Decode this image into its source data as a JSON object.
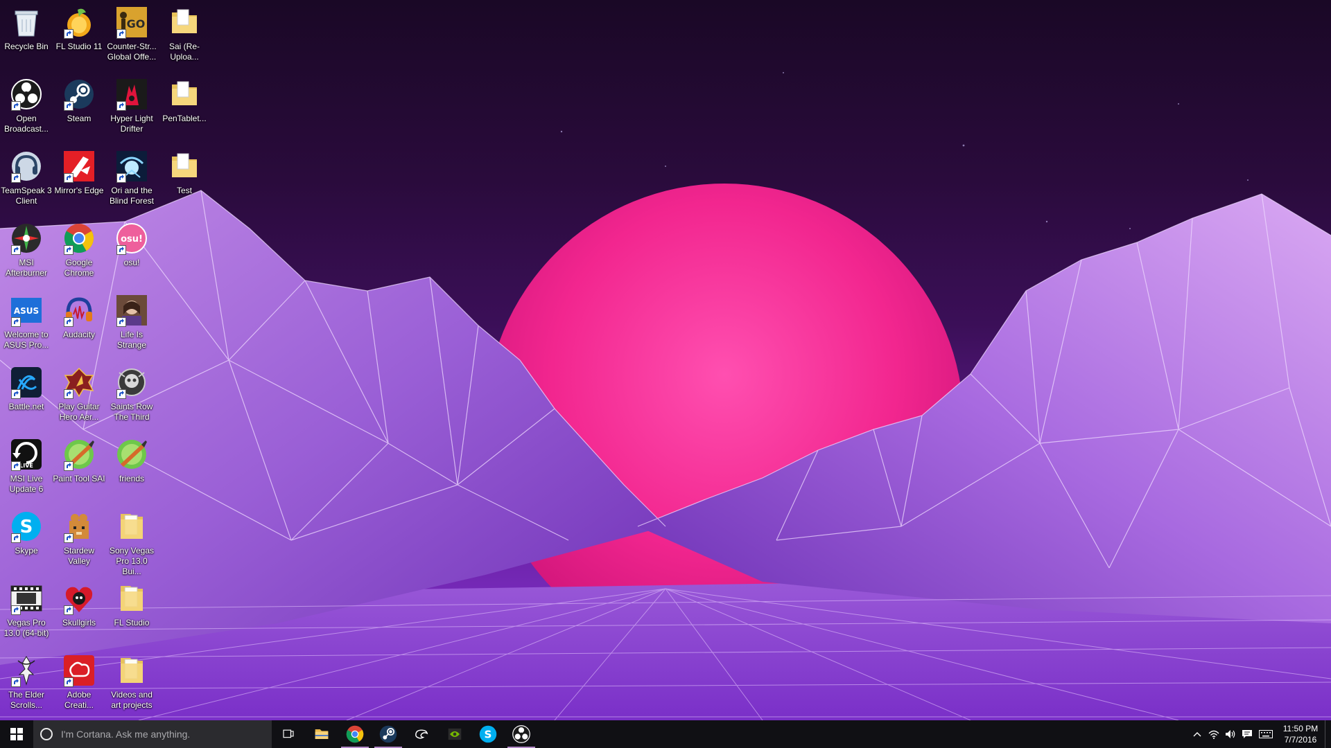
{
  "desktop": {
    "icons": [
      {
        "label": "Recycle Bin",
        "icon": "recycle-bin-icon",
        "col": 0,
        "row": 0,
        "shortcut": false
      },
      {
        "label": "FL Studio 11",
        "icon": "fl-studio-icon",
        "col": 1,
        "row": 0,
        "shortcut": true
      },
      {
        "label": "Counter-Str... Global Offe...",
        "icon": "csgo-icon",
        "col": 2,
        "row": 0,
        "shortcut": true
      },
      {
        "label": "Sai (Re-Uploa...",
        "icon": "folder-icon",
        "col": 3,
        "row": 0,
        "shortcut": false
      },
      {
        "label": "Open Broadcast...",
        "icon": "obs-icon",
        "col": 0,
        "row": 1,
        "shortcut": true
      },
      {
        "label": "Steam",
        "icon": "steam-icon",
        "col": 1,
        "row": 1,
        "shortcut": true
      },
      {
        "label": "Hyper Light Drifter",
        "icon": "hyper-light-drifter-icon",
        "col": 2,
        "row": 1,
        "shortcut": true
      },
      {
        "label": "PenTablet...",
        "icon": "folder-icon",
        "col": 3,
        "row": 1,
        "shortcut": false
      },
      {
        "label": "TeamSpeak 3 Client",
        "icon": "teamspeak-icon",
        "col": 0,
        "row": 2,
        "shortcut": true
      },
      {
        "label": "Mirror's Edge",
        "icon": "mirrors-edge-icon",
        "col": 1,
        "row": 2,
        "shortcut": true
      },
      {
        "label": "Ori and the Blind Forest",
        "icon": "ori-icon",
        "col": 2,
        "row": 2,
        "shortcut": true
      },
      {
        "label": "Test",
        "icon": "folder-icon",
        "col": 3,
        "row": 2,
        "shortcut": false
      },
      {
        "label": "MSI Afterburner",
        "icon": "msi-afterburner-icon",
        "col": 0,
        "row": 3,
        "shortcut": true
      },
      {
        "label": "Google Chrome",
        "icon": "chrome-icon",
        "col": 1,
        "row": 3,
        "shortcut": true
      },
      {
        "label": "osu!",
        "icon": "osu-icon",
        "col": 2,
        "row": 3,
        "shortcut": true
      },
      {
        "label": "Welcome to ASUS Pro...",
        "icon": "asus-icon",
        "col": 0,
        "row": 4,
        "shortcut": true
      },
      {
        "label": "Audacity",
        "icon": "audacity-icon",
        "col": 1,
        "row": 4,
        "shortcut": true
      },
      {
        "label": "Life Is Strange",
        "icon": "life-is-strange-icon",
        "col": 2,
        "row": 4,
        "shortcut": true
      },
      {
        "label": "Battle.net",
        "icon": "battlenet-icon",
        "col": 0,
        "row": 5,
        "shortcut": true
      },
      {
        "label": "Play Guitar Hero Aer...",
        "icon": "guitar-hero-icon",
        "col": 1,
        "row": 5,
        "shortcut": true
      },
      {
        "label": "Saints Row The Third",
        "icon": "saints-row-icon",
        "col": 2,
        "row": 5,
        "shortcut": true
      },
      {
        "label": "MSI Live Update 6",
        "icon": "msi-live-update-icon",
        "col": 0,
        "row": 6,
        "shortcut": true
      },
      {
        "label": "Paint Tool SAI",
        "icon": "paint-tool-sai-icon",
        "col": 1,
        "row": 6,
        "shortcut": true
      },
      {
        "label": "friends",
        "icon": "paint-tool-sai-icon",
        "col": 2,
        "row": 6,
        "shortcut": false
      },
      {
        "label": "Skype",
        "icon": "skype-icon",
        "col": 0,
        "row": 7,
        "shortcut": true
      },
      {
        "label": "Stardew Valley",
        "icon": "stardew-valley-icon",
        "col": 1,
        "row": 7,
        "shortcut": true
      },
      {
        "label": "Sony Vegas Pro 13.0 Bui...",
        "icon": "folder-doc-icon",
        "col": 2,
        "row": 7,
        "shortcut": false
      },
      {
        "label": "Vegas Pro 13.0 (64-bit)",
        "icon": "vegas-pro-icon",
        "col": 0,
        "row": 8,
        "shortcut": true
      },
      {
        "label": "Skullgirls",
        "icon": "skullgirls-icon",
        "col": 1,
        "row": 8,
        "shortcut": true
      },
      {
        "label": "FL Studio",
        "icon": "folder-doc-icon",
        "col": 2,
        "row": 8,
        "shortcut": false
      },
      {
        "label": "The Elder Scrolls...",
        "icon": "elder-scrolls-icon",
        "col": 0,
        "row": 9,
        "shortcut": true
      },
      {
        "label": "Adobe Creati...",
        "icon": "adobe-cc-icon",
        "col": 1,
        "row": 9,
        "shortcut": true
      },
      {
        "label": "Videos and art projects",
        "icon": "folder-doc-icon",
        "col": 2,
        "row": 9,
        "shortcut": false
      }
    ]
  },
  "taskbar": {
    "search_placeholder": "I'm Cortana. Ask me anything.",
    "pinned": [
      {
        "name": "task-view-button",
        "icon": "task-view-icon",
        "state": ""
      },
      {
        "name": "file-explorer-button",
        "icon": "file-explorer-icon",
        "state": ""
      },
      {
        "name": "chrome-taskbar-button",
        "icon": "chrome-icon",
        "state": "running"
      },
      {
        "name": "steam-taskbar-button",
        "icon": "steam-icon",
        "state": "running"
      },
      {
        "name": "razer-taskbar-button",
        "icon": "razer-icon",
        "state": ""
      },
      {
        "name": "nvidia-taskbar-button",
        "icon": "nvidia-icon",
        "state": ""
      },
      {
        "name": "skype-taskbar-button",
        "icon": "skype-icon",
        "state": ""
      },
      {
        "name": "obs-taskbar-button",
        "icon": "obs-icon",
        "state": "running"
      }
    ],
    "clock": {
      "time": "11:50 PM",
      "date": "7/7/2016"
    }
  },
  "colors": {
    "sun": "#ff2f9a",
    "grid": "#e7c8ff",
    "taskbar": "#101014",
    "search_box": "#2b2b2f"
  }
}
